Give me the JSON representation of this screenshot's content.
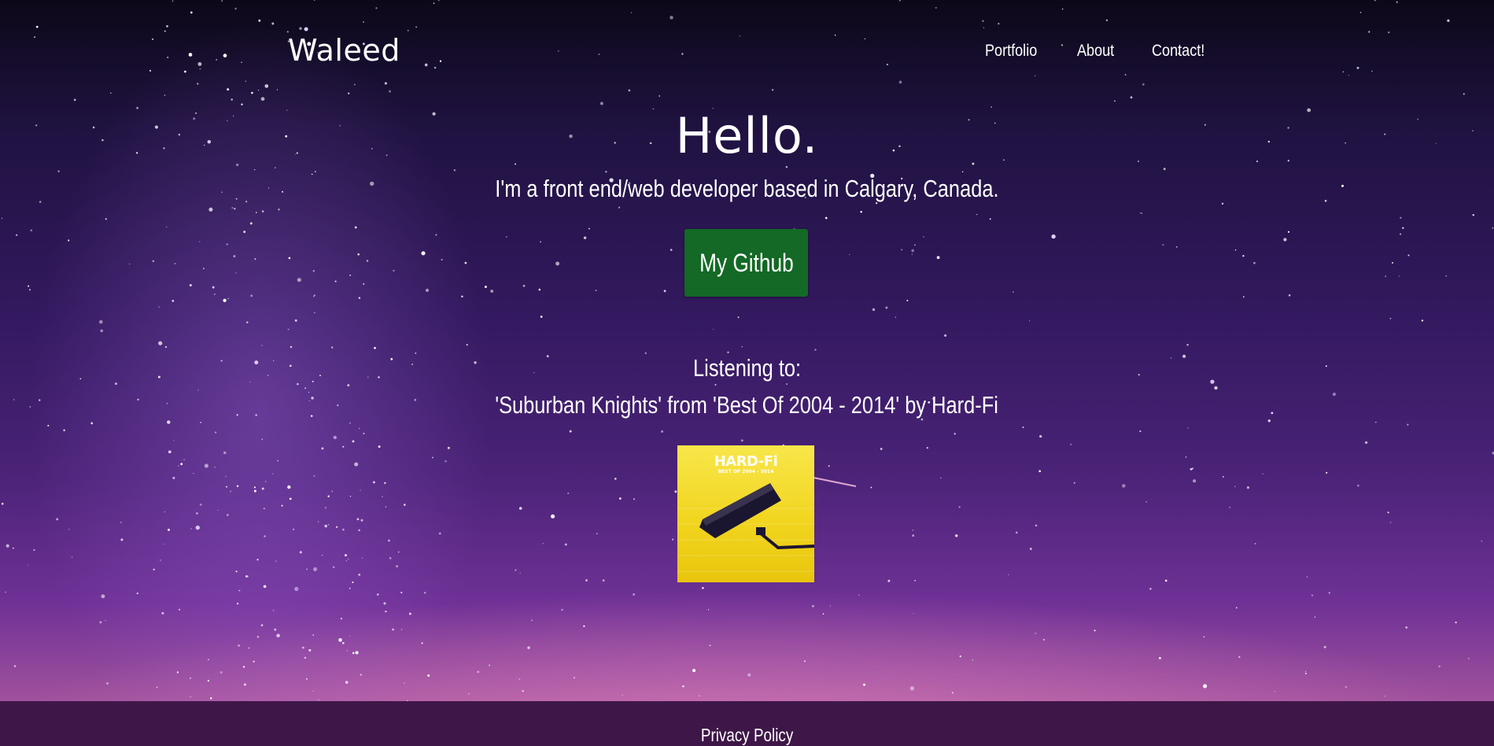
{
  "nav": {
    "brand": "Waleed",
    "links": [
      "Portfolio",
      "About",
      "Contact!"
    ]
  },
  "hero": {
    "heading": "Hello.",
    "tagline": "I'm a front end/web developer based in Calgary, Canada.",
    "github_button": "My Github"
  },
  "now_playing": {
    "label": "Listening to:",
    "track_line": "'Suburban Knights' from 'Best Of 2004 - 2014' by Hard-Fi",
    "album_art_title": "HARD-Fi",
    "album_art_subtitle": "BEST OF 2004 - 2014"
  },
  "footer": {
    "privacy_link": "Privacy Policy"
  },
  "colors": {
    "github_button_bg": "#136925",
    "footer_bg": "#3e1748",
    "text": "#ffffff"
  }
}
